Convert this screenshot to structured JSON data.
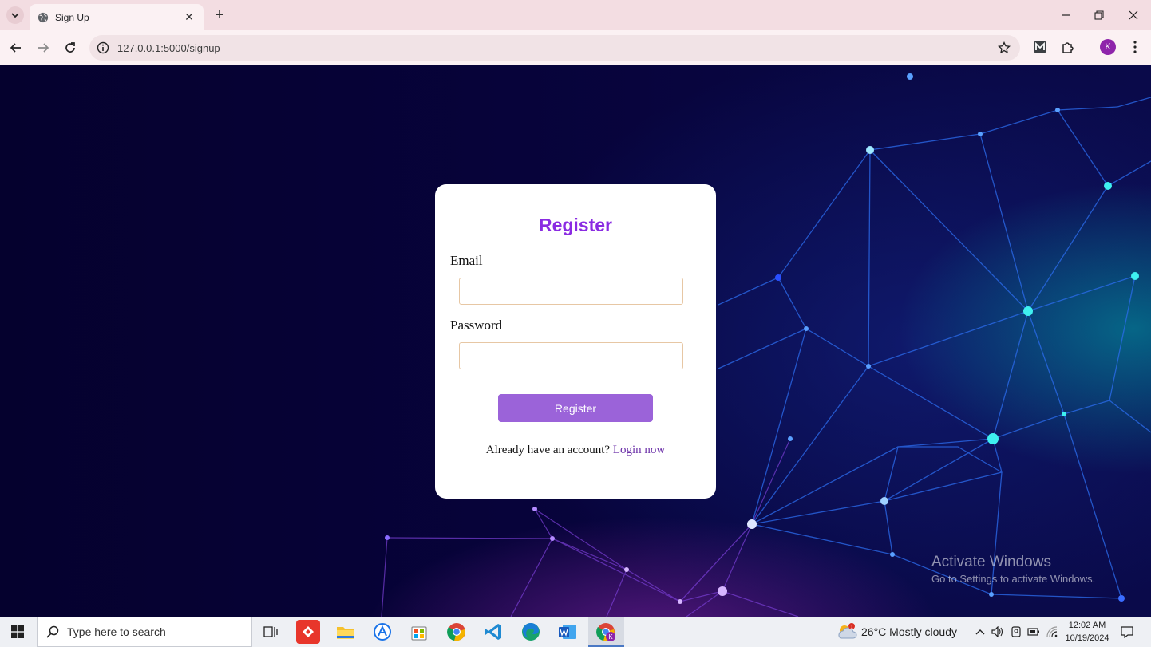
{
  "browser": {
    "tab_title": "Sign Up",
    "url": "127.0.0.1:5000/signup",
    "profile_initial": "K"
  },
  "form": {
    "title": "Register",
    "email_label": "Email",
    "email_value": "",
    "password_label": "Password",
    "password_value": "",
    "submit_label": "Register",
    "login_prompt": "Already have an account?",
    "login_link": "Login now"
  },
  "watermark": {
    "line1": "Activate Windows",
    "line2": "Go to Settings to activate Windows."
  },
  "taskbar": {
    "search_placeholder": "Type here to search",
    "weather": "26°C  Mostly cloudy",
    "weather_badge": "1",
    "time": "12:02 AM",
    "date": "10/19/2024",
    "chrome_badge": "K"
  },
  "colors": {
    "accent": "#8a2be2",
    "button": "#9b63d9",
    "link": "#6b2fa8"
  }
}
